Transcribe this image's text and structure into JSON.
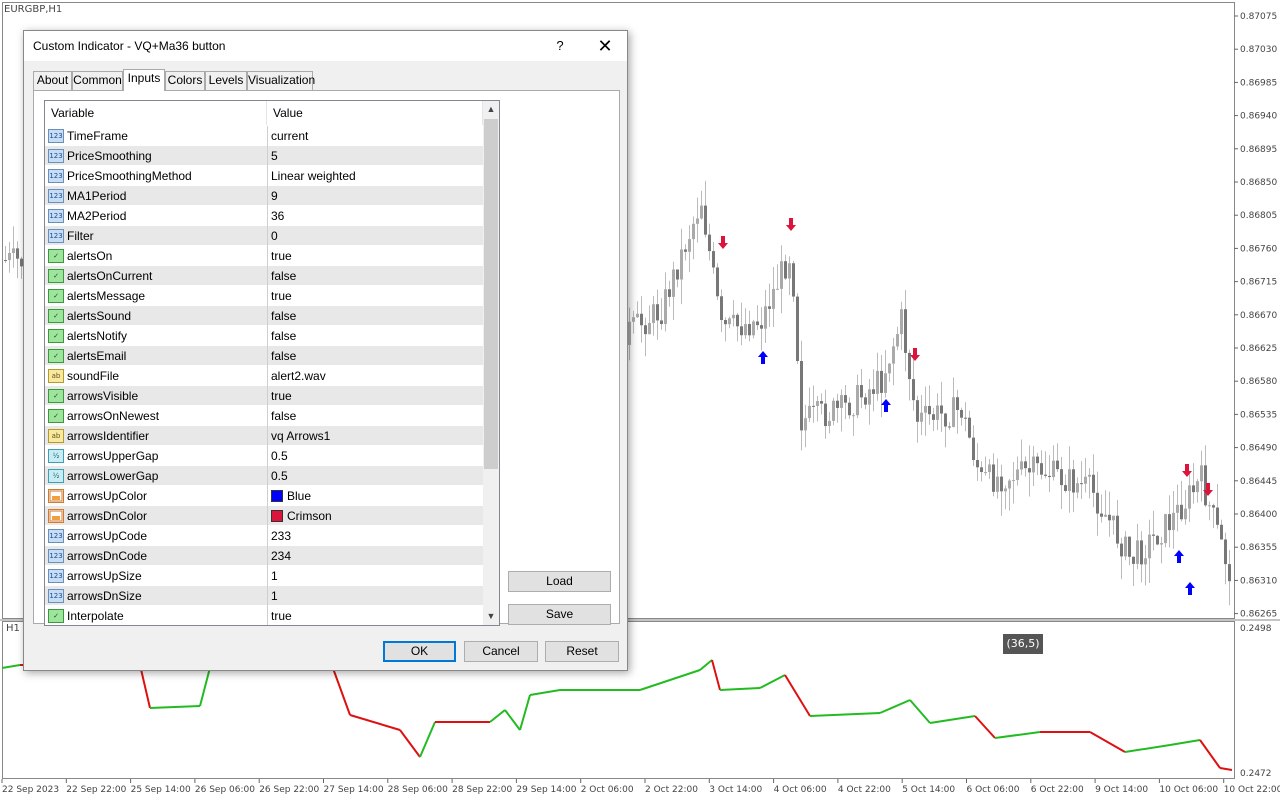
{
  "chart": {
    "symbol": "EURGBP,H1",
    "sub_label": "H1",
    "tooltip": "(36,5)",
    "price_labels": [
      "0.87075",
      "0.87030",
      "0.86985",
      "0.86940",
      "0.86895",
      "0.86850",
      "0.86805",
      "0.86760",
      "0.86715",
      "0.86670",
      "0.86625",
      "0.86580",
      "0.86535",
      "0.86490",
      "0.86445",
      "0.86400",
      "0.86355",
      "0.86310",
      "0.86265"
    ],
    "sub_labels": [
      "0.2498",
      "0.2472"
    ],
    "time_labels": [
      "22 Sep 2023",
      "22 Sep 22:00",
      "25 Sep 14:00",
      "26 Sep 06:00",
      "26 Sep 22:00",
      "27 Sep 14:00",
      "28 Sep 06:00",
      "28 Sep 22:00",
      "29 Sep 14:00",
      "2 Oct 06:00",
      "2 Oct 22:00",
      "3 Oct 14:00",
      "4 Oct 06:00",
      "4 Oct 22:00",
      "5 Oct 14:00",
      "6 Oct 06:00",
      "6 Oct 22:00",
      "9 Oct 14:00",
      "10 Oct 06:00",
      "10 Oct 22:00"
    ],
    "up_color": "#0000ff",
    "down_color": "#dc143c",
    "indicator_up_color": "#22bb22",
    "indicator_down_color": "#dd1111"
  },
  "dialog": {
    "title": "Custom Indicator - VQ+Ma36 button",
    "help": "?",
    "close": "✕",
    "tabs": [
      "About",
      "Common",
      "Inputs",
      "Colors",
      "Levels",
      "Visualization"
    ],
    "active_tab": "Inputs",
    "headers": {
      "variable": "Variable",
      "value": "Value"
    },
    "rows": [
      {
        "icon": "int",
        "icon_text": "123",
        "name": "TimeFrame",
        "value": "current"
      },
      {
        "icon": "int",
        "icon_text": "123",
        "name": "PriceSmoothing",
        "value": "5"
      },
      {
        "icon": "int",
        "icon_text": "123",
        "name": "PriceSmoothingMethod",
        "value": "Linear weighted"
      },
      {
        "icon": "int",
        "icon_text": "123",
        "name": "MA1Period",
        "value": "9"
      },
      {
        "icon": "int",
        "icon_text": "123",
        "name": "MA2Period",
        "value": "36"
      },
      {
        "icon": "int",
        "icon_text": "123",
        "name": "Filter",
        "value": "0"
      },
      {
        "icon": "bool",
        "icon_text": "✓",
        "name": "alertsOn",
        "value": "true"
      },
      {
        "icon": "bool",
        "icon_text": "✓",
        "name": "alertsOnCurrent",
        "value": "false"
      },
      {
        "icon": "bool",
        "icon_text": "✓",
        "name": "alertsMessage",
        "value": "true"
      },
      {
        "icon": "bool",
        "icon_text": "✓",
        "name": "alertsSound",
        "value": "false"
      },
      {
        "icon": "bool",
        "icon_text": "✓",
        "name": "alertsNotify",
        "value": "false"
      },
      {
        "icon": "bool",
        "icon_text": "✓",
        "name": "alertsEmail",
        "value": "false"
      },
      {
        "icon": "str",
        "icon_text": "ab",
        "name": "soundFile",
        "value": "alert2.wav"
      },
      {
        "icon": "bool",
        "icon_text": "✓",
        "name": "arrowsVisible",
        "value": "true"
      },
      {
        "icon": "bool",
        "icon_text": "✓",
        "name": "arrowsOnNewest",
        "value": "false"
      },
      {
        "icon": "str",
        "icon_text": "ab",
        "name": "arrowsIdentifier",
        "value": "vq Arrows1"
      },
      {
        "icon": "dbl",
        "icon_text": "½",
        "name": "arrowsUpperGap",
        "value": "0.5"
      },
      {
        "icon": "dbl",
        "icon_text": "½",
        "name": "arrowsLowerGap",
        "value": "0.5"
      },
      {
        "icon": "clr",
        "icon_text": "",
        "name": "arrowsUpColor",
        "value": "Blue",
        "swatch": "#0000ff"
      },
      {
        "icon": "clr",
        "icon_text": "",
        "name": "arrowsDnColor",
        "value": "Crimson",
        "swatch": "#dc143c"
      },
      {
        "icon": "int",
        "icon_text": "123",
        "name": "arrowsUpCode",
        "value": "233"
      },
      {
        "icon": "int",
        "icon_text": "123",
        "name": "arrowsDnCode",
        "value": "234"
      },
      {
        "icon": "int",
        "icon_text": "123",
        "name": "arrowsUpSize",
        "value": "1"
      },
      {
        "icon": "int",
        "icon_text": "123",
        "name": "arrowsDnSize",
        "value": "1"
      },
      {
        "icon": "bool",
        "icon_text": "✓",
        "name": "Interpolate",
        "value": "true"
      }
    ],
    "buttons": {
      "load": "Load",
      "save": "Save",
      "ok": "OK",
      "cancel": "Cancel",
      "reset": "Reset"
    }
  }
}
